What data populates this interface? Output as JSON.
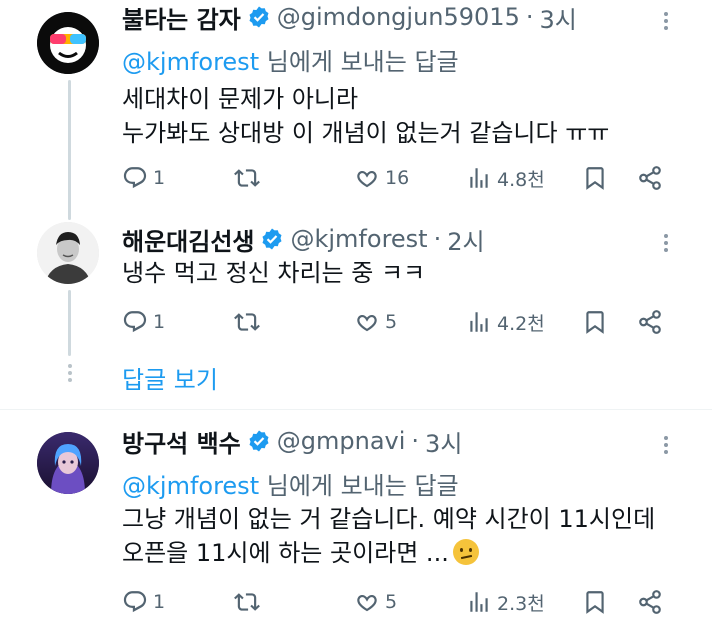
{
  "replies": [
    {
      "name": "불타는 감자",
      "handle": "@gimdongjun59015",
      "dot": "·",
      "time": "3시",
      "replying_to": "@kjmforest",
      "replying_suffix": " 님에게 보내는 답글",
      "text_lines": [
        "세대차이 문제가 아니라",
        "누가봐도  상대방 이 개념이 없는거 같습니다 ㅠㅠ"
      ],
      "counts": {
        "replies": "1",
        "reposts": "",
        "likes": "16",
        "views": "4.8천"
      }
    },
    {
      "name": "해운대김선생",
      "handle": "@kjmforest",
      "dot": "·",
      "time": "2시",
      "text_lines": [
        "냉수 먹고 정신 차리는 중 ㅋㅋ"
      ],
      "counts": {
        "replies": "1",
        "reposts": "",
        "likes": "5",
        "views": "4.2천"
      }
    },
    {
      "name": "방구석 백수",
      "handle": "@gmpnavi",
      "dot": "·",
      "time": "3시",
      "replying_to": "@kjmforest",
      "replying_suffix": " 님에게 보내는 답글",
      "text_lines": [
        "그냥 개념이 없는 거 같습니다. 예약 시간이 11시인데",
        "오픈을 11시에 하는 곳이라면 ..."
      ],
      "counts": {
        "replies": "1",
        "reposts": "",
        "likes": "5",
        "views": "2.3천"
      }
    }
  ],
  "show_replies_label": "답글 보기",
  "icons": {
    "verified": "verified-badge-icon",
    "reply": "reply-icon",
    "repost": "repost-icon",
    "like": "heart-icon",
    "views": "views-icon",
    "bookmark": "bookmark-icon",
    "share": "share-icon",
    "more": "more-icon",
    "emoji": "confused-face-emoji"
  },
  "colors": {
    "accent": "#1d9bf0",
    "text": "#0f1419",
    "muted": "#536471",
    "thread_line": "#cfd9de"
  }
}
